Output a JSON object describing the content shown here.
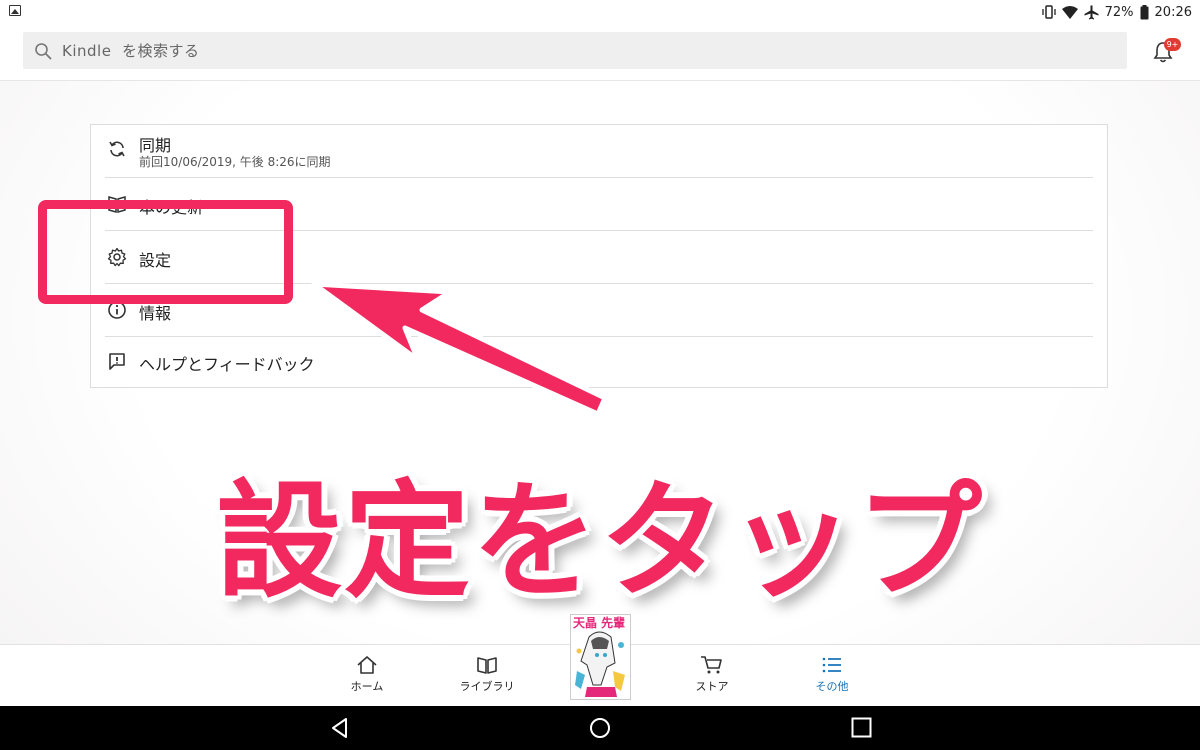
{
  "status_bar": {
    "battery": "72%",
    "time": "20:26"
  },
  "search": {
    "text": "Kindle  を検索する",
    "notification_badge": "9+"
  },
  "menu": [
    {
      "label": "同期",
      "sub": "前回10/06/2019, 午後 8:26に同期",
      "icon": "sync-icon"
    },
    {
      "label": "本の更新",
      "icon": "book-update-icon"
    },
    {
      "label": "設定",
      "icon": "gear-icon"
    },
    {
      "label": "情報",
      "icon": "info-icon"
    },
    {
      "label": "ヘルプとフィードバック",
      "icon": "feedback-icon"
    }
  ],
  "annotation": {
    "caption": "設定をタップ",
    "color": "#f2295f"
  },
  "bottom_nav": {
    "home": "ホーム",
    "library": "ライブラリ",
    "book_cover_title": "天晶 先輩",
    "store": "ストア",
    "more": "その他",
    "active_color": "#1a73b8"
  }
}
